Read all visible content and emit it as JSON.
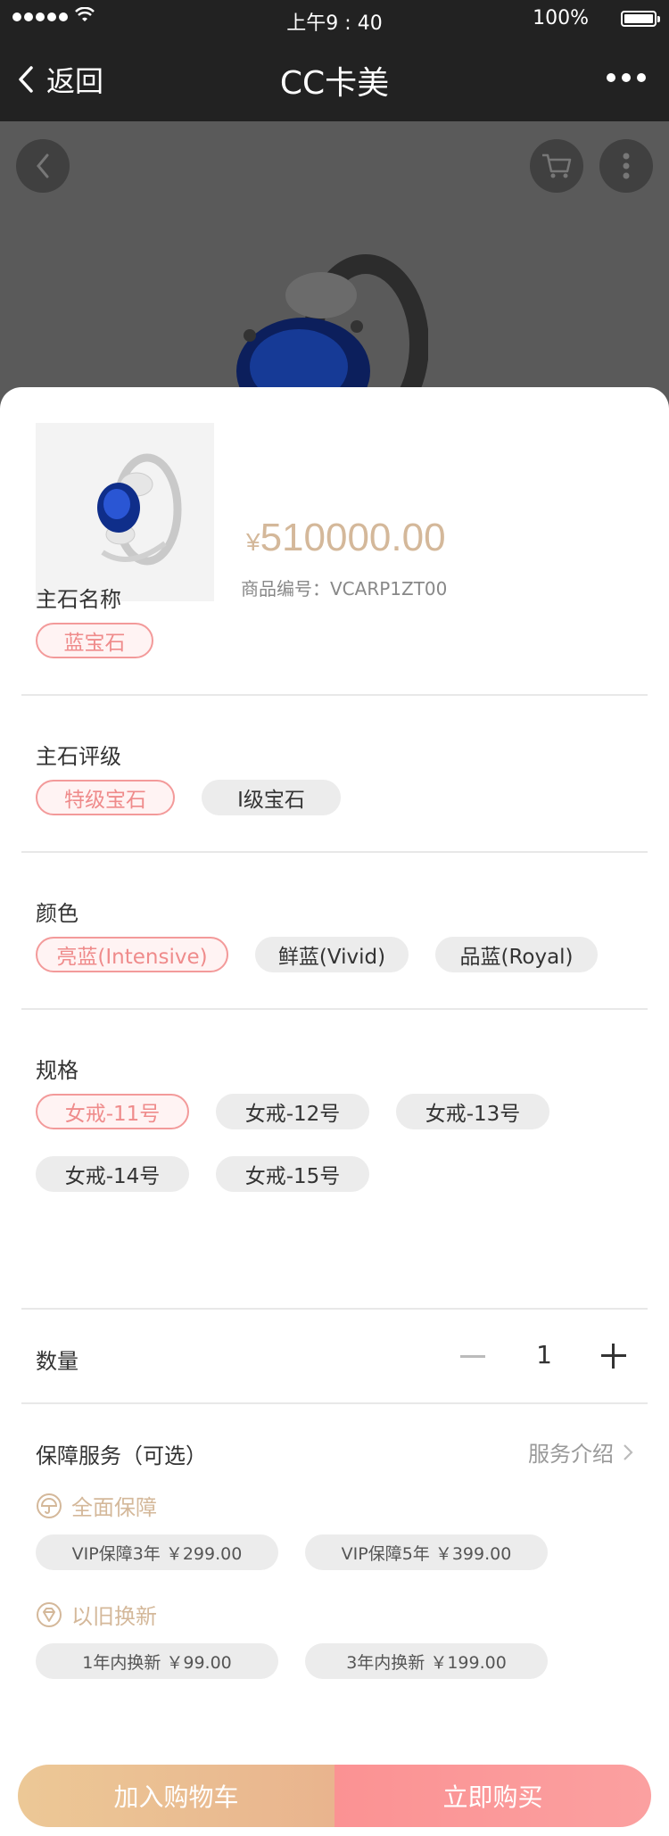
{
  "status_bar": {
    "time": "上午9 : 40",
    "battery": "100%"
  },
  "nav": {
    "back_label": "返回",
    "title": "CC卡美"
  },
  "product": {
    "currency": "¥",
    "price": "510000.00",
    "sku": "商品编号：VCARP1ZT00"
  },
  "stone_name": {
    "title": "主石名称",
    "options": [
      "蓝宝石"
    ],
    "selected": 0
  },
  "stone_grade": {
    "title": "主石评级",
    "options": [
      "特级宝石",
      "Ⅰ级宝石"
    ],
    "selected": 0
  },
  "color": {
    "title": "颜色",
    "options": [
      "亮蓝(Intensive)",
      "鲜蓝(Vivid)",
      "品蓝(Royal)"
    ],
    "selected": 0
  },
  "size": {
    "title": "规格",
    "options": [
      "女戒-11号",
      "女戒-12号",
      "女戒-13号",
      "女戒-14号",
      "女戒-15号"
    ],
    "selected": 0
  },
  "quantity": {
    "title": "数量",
    "value": "1"
  },
  "service": {
    "title": "保障服务（可选）",
    "intro_link": "服务介绍",
    "groups": [
      {
        "label": "全面保障",
        "icon": "umbrella-icon",
        "options": [
          "VIP保障3年 ￥299.00",
          "VIP保障5年 ￥399.00"
        ]
      },
      {
        "label": "以旧换新",
        "icon": "diamond-icon",
        "options": [
          "1年内换新 ￥99.00",
          "3年内换新 ￥199.00"
        ]
      }
    ]
  },
  "actions": {
    "add_to_cart": "加入购物车",
    "buy_now": "立即购买"
  },
  "colors": {
    "accent_pink": "#ef8b8b",
    "gold": "#d4b89a",
    "nav_bg": "#222222"
  }
}
